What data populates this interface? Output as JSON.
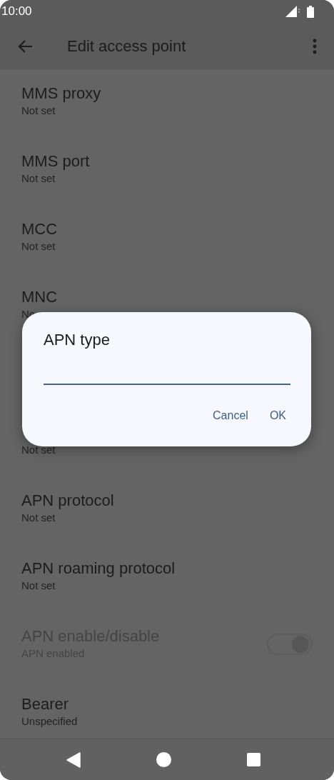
{
  "status_bar": {
    "time": "10:00"
  },
  "app_bar": {
    "title": "Edit access point"
  },
  "rows": [
    {
      "kind": "text",
      "title": "MMS proxy",
      "summary": "Not set"
    },
    {
      "kind": "text",
      "title": "MMS port",
      "summary": "Not set"
    },
    {
      "kind": "text",
      "title": "MCC",
      "summary": "Not set"
    },
    {
      "kind": "text",
      "title": "MNC",
      "summary": "No"
    },
    {
      "kind": "gap"
    },
    {
      "kind": "text",
      "summary": "Not set"
    },
    {
      "kind": "text",
      "title": "APN protocol",
      "summary": "Not set"
    },
    {
      "kind": "text",
      "title": "APN roaming protocol",
      "summary": "Not set"
    },
    {
      "kind": "switch",
      "title": "APN enable/disable",
      "summary": "APN enabled",
      "disabled": true,
      "on": true
    },
    {
      "kind": "text",
      "title": "Bearer",
      "summary": "Unspecified"
    }
  ],
  "dialog": {
    "title": "APN type",
    "buttons": [
      "Cancel",
      "OK"
    ]
  }
}
